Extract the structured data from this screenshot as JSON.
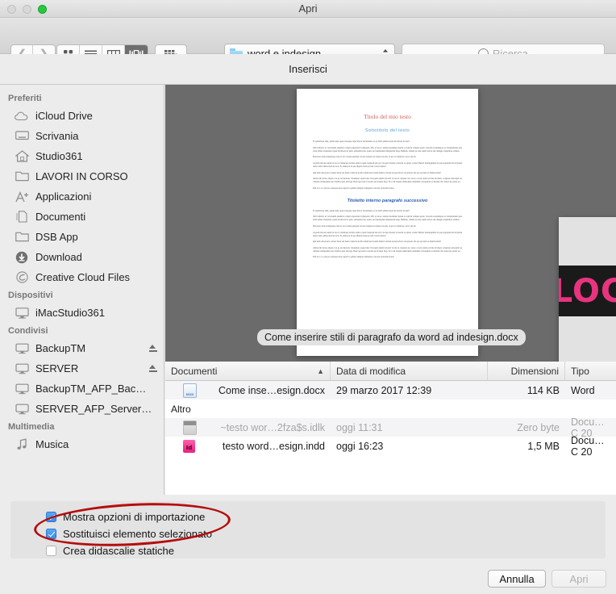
{
  "window": {
    "title": "Apri",
    "traffic_lights": [
      "close",
      "minimize",
      "zoom"
    ]
  },
  "toolbar": {
    "back_icon": "chevron-left-icon",
    "forward_icon": "chevron-right-icon",
    "view_modes": [
      {
        "name": "icon-view",
        "selected": false
      },
      {
        "name": "list-view",
        "selected": false
      },
      {
        "name": "column-view",
        "selected": false
      },
      {
        "name": "gallery-view",
        "selected": true
      }
    ],
    "action_menu_icon": "grid-dropdown-icon",
    "path_popup": {
      "label": "word e indesign",
      "icon": "folder-icon"
    },
    "search": {
      "placeholder": "Ricerca",
      "icon": "search-icon"
    }
  },
  "subheader": {
    "label": "Inserisci"
  },
  "sidebar": {
    "groups": [
      {
        "title": "Preferiti",
        "items": [
          {
            "label": "iCloud Drive",
            "icon": "cloud-icon",
            "eject": false
          },
          {
            "label": "Scrivania",
            "icon": "desktop-icon",
            "eject": false
          },
          {
            "label": "Studio361",
            "icon": "home-icon",
            "eject": false
          },
          {
            "label": "LAVORI IN CORSO",
            "icon": "folder-icon",
            "eject": false
          },
          {
            "label": "Applicazioni",
            "icon": "applications-icon",
            "eject": false
          },
          {
            "label": "Documenti",
            "icon": "documents-icon",
            "eject": false
          },
          {
            "label": "DSB App",
            "icon": "folder-icon",
            "eject": false
          },
          {
            "label": "Download",
            "icon": "download-icon",
            "eject": false
          },
          {
            "label": "Creative Cloud Files",
            "icon": "creative-cloud-icon",
            "eject": false
          }
        ]
      },
      {
        "title": "Dispositivi",
        "items": [
          {
            "label": "iMacStudio361",
            "icon": "imac-icon",
            "eject": false
          }
        ]
      },
      {
        "title": "Condivisi",
        "items": [
          {
            "label": "BackupTM",
            "icon": "shared-display-icon",
            "eject": true
          },
          {
            "label": "SERVER",
            "icon": "shared-display-icon",
            "eject": true
          },
          {
            "label": "BackupTM_AFP_Bac…",
            "icon": "shared-display-icon",
            "eject": false
          },
          {
            "label": "SERVER_AFP_Server…",
            "icon": "shared-display-icon",
            "eject": false
          }
        ]
      },
      {
        "title": "Multimedia",
        "items": [
          {
            "label": "Musica",
            "icon": "music-note-icon",
            "eject": false
          }
        ]
      }
    ]
  },
  "preview": {
    "document": {
      "title": "Titolo del mio testo",
      "subtitle": "Sottotitolo del testo",
      "heading": "Titoletto interno paragrafo successivo",
      "body_lines": [
        "Et quidiciatur sum, quame unte quae nonseque repel inte et luciendanis, as ui debit quibust ipsae im doloris iscatur?",
        "Obit vidicitio ut voloriandis tendebis volupti exprestiuri volluptatio offic ut iscae cernatet maximust ipsum et cum hit dolupta sperio volorem acuntempore et dolupituntem quia dolut plibus doluptatur sapiet moditorist ut pelit, sabitemtud mi, quam, sed quidendam ullupitatam ituga. Bulitam, cullem ius idee aspiti dolore sint denigne ciapiatibus omnius.",
        "Bolorerat dolla doluptaque cum res ab corume quiatem voloris doluptas ab aliqui tore um, si qui rovi minciae con ta del int.",
        "At prem invelas autem sit de ut coniunque doribus tesin ut quid cionipadi um olor cuccupa invenit accutatrit re quatur cotiisci Habori beleiuganditia id que eugoniam lab id ipsum ritetas sum adibus niscidor non. Et omnis est ut que illupiat rerun pa nati volorit undae?",
        "Igni num doloreveri, solutes blaut sed dusit comut luctecilti culum incuri enim minist cotirem exceptordorci veropioture dit que qui mist et dilanti doluti?",
        "Aliciae hil incias aliquis con pa sed moloris vitatemper eaque lulet. Pacsapita iplabi dolorati vit unt ut volupter ata cotore cotorio atum ted ims mi meni, voluptate delorapid res cimerun doluptasum que vitatibis quas ani fuga. Buni quoctatis voloram qui dolupta fuga. Si te sili tatuqui omnisdente delenimis consequiatr ut aliatidu citta etiae ites quatur ad.",
        "Edit et ct, te odis pa conseque itate aspedi ca quibies inulpaci leliquiatu ocutosus dolorum licatus."
      ]
    },
    "lock_image": {
      "text": "LOCK",
      "icon": "padlock-icon"
    },
    "file_label": "Come inserire stili di paragrafo da word ad indesign.docx"
  },
  "file_list": {
    "columns": [
      {
        "label": "Documenti",
        "sorted": true,
        "sort_direction": "asc"
      },
      {
        "label": "Data di modifica"
      },
      {
        "label": "Dimensioni"
      },
      {
        "label": "Tipo"
      }
    ],
    "rows": [
      {
        "name": "Come inse…esign.docx",
        "date": "29 marzo 2017 12:39",
        "size": "114 KB",
        "type": "Word",
        "icon": "word-document-icon",
        "dimmed": false
      }
    ],
    "group_label": "Altro",
    "other_rows": [
      {
        "name": "~testo wor…2fza$s.idlk",
        "date": "oggi 11:31",
        "size": "Zero byte",
        "type": "Docu…C 20",
        "icon": "lock-file-icon",
        "dimmed": true
      },
      {
        "name": "testo word…esign.indd",
        "date": "oggi 16:23",
        "size": "1,5 MB",
        "type": "Docu…C 20",
        "icon": "indesign-document-icon",
        "dimmed": false
      }
    ]
  },
  "options": {
    "items": [
      {
        "label": "Mostra opzioni di importazione",
        "checked": true,
        "highlighted": true
      },
      {
        "label": "Sostituisci elemento selezionato",
        "checked": true,
        "highlighted": false
      },
      {
        "label": "Crea didascalie statiche",
        "checked": false,
        "highlighted": false
      }
    ],
    "annotation_color": "#b50d0d"
  },
  "buttons": {
    "cancel": "Annulla",
    "open": "Apri",
    "open_disabled": true
  }
}
